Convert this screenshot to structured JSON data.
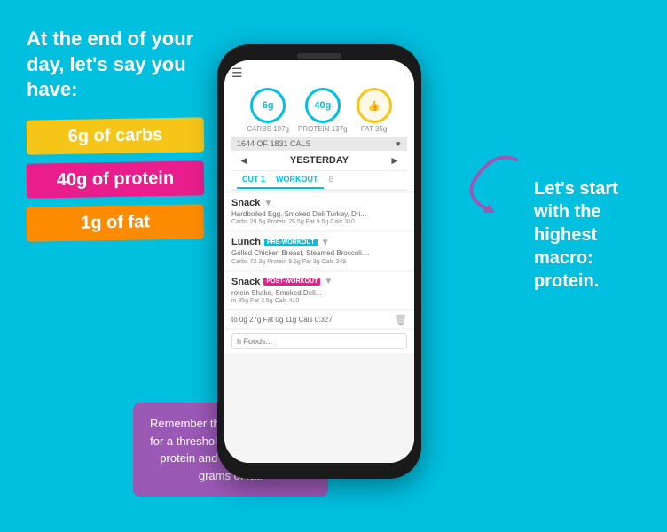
{
  "background_color": "#00BFDF",
  "left": {
    "intro": "At the end of your day, let's say you have:",
    "badge1": "6g of carbs",
    "badge2": "40g of protein",
    "badge3": "1g of fat"
  },
  "right": {
    "text": "Let's start with the highest macro: protein."
  },
  "note": {
    "text": "Remember the app will account for a threshold of +/- 5 grams of protein and carbs, and +/- 2 grams of fat."
  },
  "phone": {
    "app": {
      "macros": {
        "carbs": {
          "value": "6g",
          "label": "CARBS",
          "sub": "197g"
        },
        "protein": {
          "value": "40g",
          "label": "PROTEIN",
          "sub": "137g"
        },
        "fat": {
          "value": "👍",
          "label": "FAT",
          "sub": "35g"
        }
      },
      "calories": "1644 OF 1831 CALS",
      "day": "YESTERDAY",
      "tabs": [
        "CUT 1",
        "WORKOUT",
        "B"
      ],
      "meals": [
        {
          "name": "Snack",
          "badge": "",
          "items": "Hardboiled Egg, Smoked Deli Turkey, Dri...",
          "macros": "Carbs 29.5g  Protein 25.5g  Fat 9.5g  Cals 310"
        },
        {
          "name": "Lunch",
          "badge": "PRE-WORKOUT",
          "items": "Grilled Chicken Breast, Steamed Broccoli....",
          "macros": "Carbs 72.3g  Protein 9.5g  Fat 3g  Cals 349"
        },
        {
          "name": "Snack",
          "badge": "POST-WORKOUT",
          "items": "rotein Shake, Smoked Deli...",
          "macros": "in 35g  Fat 3.5g  Cals 410"
        }
      ],
      "last_row_macros": "to 0g  27g  Fat 0g  11g  Cals 0:327",
      "add_food_placeholder": "h Foods..."
    }
  }
}
